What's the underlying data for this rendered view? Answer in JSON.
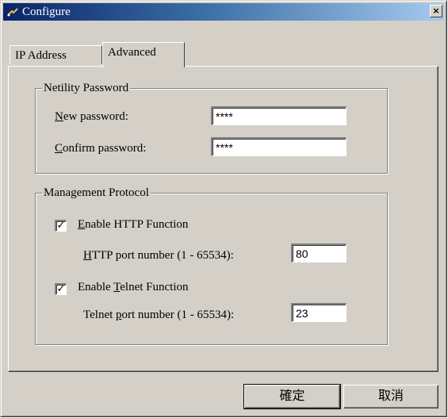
{
  "window": {
    "title": "Configure",
    "close_glyph": "×"
  },
  "tabs": [
    {
      "label": "IP Address",
      "active": false
    },
    {
      "label": "Advanced",
      "active": true
    }
  ],
  "password_group": {
    "title": "Netility Password",
    "new_password": {
      "label_u": "N",
      "label_rest": "ew password:",
      "value": "****"
    },
    "confirm_password": {
      "label_u": "C",
      "label_rest": "onfirm password:",
      "value": "****"
    }
  },
  "protocol_group": {
    "title": "Management Protocol",
    "http": {
      "enable_u": "E",
      "enable_rest": "nable HTTP Function",
      "checked": true,
      "check_glyph": "✓",
      "port_u": "H",
      "port_rest": "TTP port number (1 - 65534):",
      "port_value": "80"
    },
    "telnet": {
      "enable_pre": "Enable ",
      "enable_u": "T",
      "enable_rest": "elnet Function",
      "checked": true,
      "check_glyph": "✓",
      "port_pre": "Telnet ",
      "port_u": "p",
      "port_rest": "ort number (1 - 65534):",
      "port_value": "23"
    }
  },
  "buttons": {
    "ok": "確定",
    "cancel": "取消"
  },
  "colors": {
    "face": "#d4d0c8",
    "title_start": "#0a246a",
    "title_end": "#a6caf0"
  }
}
